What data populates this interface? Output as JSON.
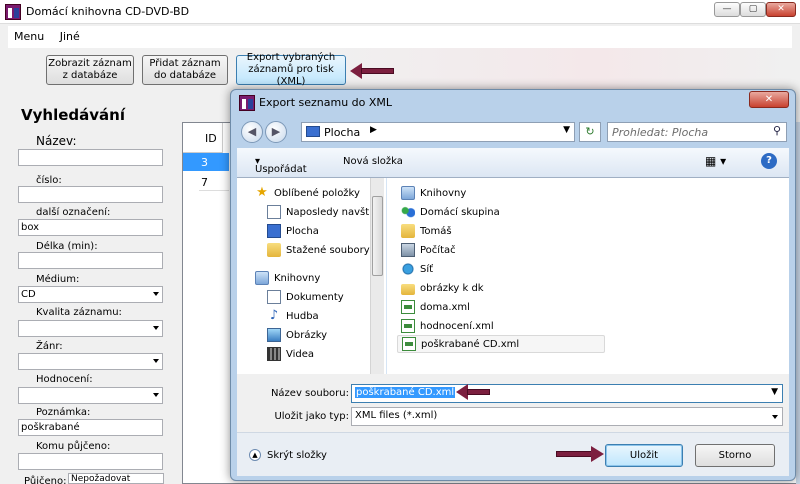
{
  "app": {
    "title": "Domácí knihovna CD-DVD-BD",
    "menu": [
      "Menu",
      "Jiné"
    ],
    "buttons": {
      "show": "Zobrazit záznam z databáze",
      "add": "Přidat záznam do databáze",
      "export": "Export vybraných záznamů pro tisk (XML)"
    },
    "search": {
      "title": "Vyhledávání",
      "name_label": "Název:",
      "name_value": "",
      "number_label": "číslo:",
      "number_value": "",
      "other_label": "další označení:",
      "other_value": "box",
      "length_label": "Délka (min):",
      "length_value": "",
      "medium_label": "Médium:",
      "medium_value": "CD",
      "quality_label": "Kvalita záznamu:",
      "quality_value": "",
      "genre_label": "Žánr:",
      "genre_value": "",
      "rating_label": "Hodnocení:",
      "rating_value": "",
      "note_label": "Poznámka:",
      "note_value": "poškrabané",
      "lent_label": "Komu půjčeno:",
      "lent_value": "",
      "borrowed_label": "Půjčeno:",
      "borrowed_value": "Nepožadovat"
    },
    "grid": {
      "column": "ID",
      "rows": [
        "3",
        "7"
      ]
    }
  },
  "dialog": {
    "title": "Export seznamu do XML",
    "location": "Plocha",
    "search_placeholder": "Prohledat: Plocha",
    "organize": "Uspořádat",
    "new_folder": "Nová složka",
    "nav": {
      "favorites": "Oblíbené položky",
      "recent": "Naposledy navšt",
      "desktop": "Plocha",
      "downloads": "Stažené soubory",
      "libraries": "Knihovny",
      "documents": "Dokumenty",
      "music": "Hudba",
      "pictures": "Obrázky",
      "video": "Videa"
    },
    "files": [
      "Knihovny",
      "Domácí skupina",
      "Tomáš",
      "Počítač",
      "Síť",
      "obrázky k dk",
      "doma.xml",
      "hodnocení.xml",
      "poškrabané CD.xml"
    ],
    "filename_label": "Název souboru:",
    "filename_value": "poškrabané CD.xml",
    "filetype_label": "Uložit jako typ:",
    "filetype_value": "XML files (*.xml)",
    "hide_folders": "Skrýt složky",
    "save": "Uložit",
    "cancel": "Storno"
  },
  "colors": {
    "accent": "#3399ff",
    "arrow": "#7c1f3f",
    "dialog_frame": "#b9d1ea"
  }
}
